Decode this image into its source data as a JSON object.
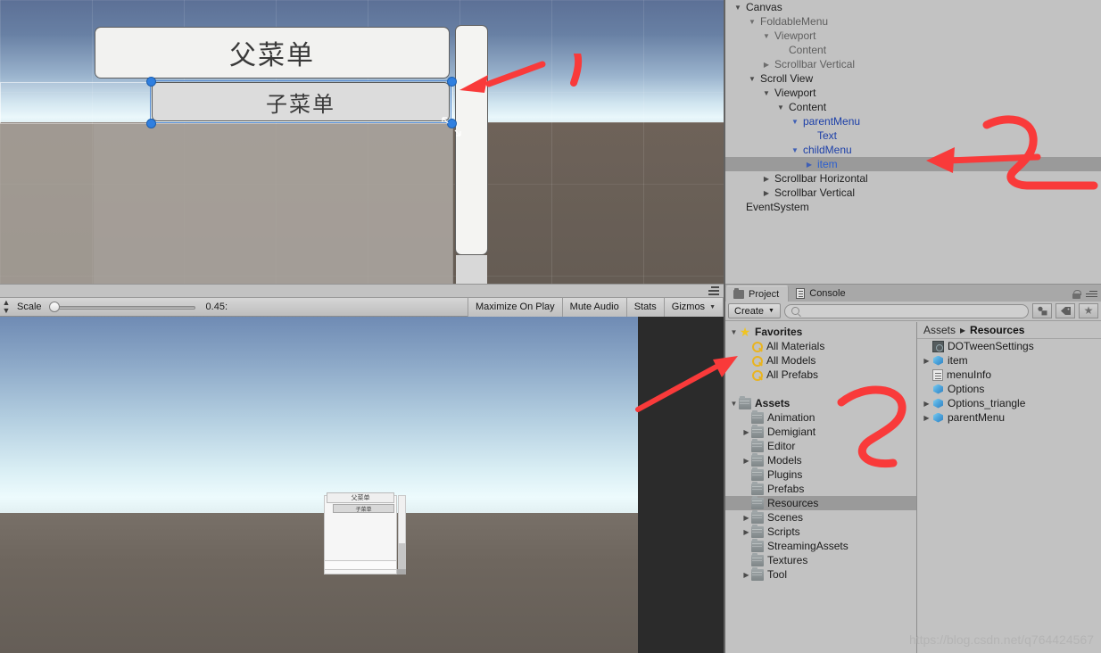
{
  "scene": {
    "parent_menu_label": "父菜单",
    "child_menu_label": "子菜单"
  },
  "game_toolbar": {
    "scale_label": "Scale",
    "scale_value": "0.45:",
    "maximize_on_play": "Maximize On Play",
    "mute_audio": "Mute Audio",
    "stats": "Stats",
    "gizmos": "Gizmos"
  },
  "game_view": {
    "parent_menu_label": "父菜单",
    "child_menu_label": "子菜单"
  },
  "hierarchy": {
    "rows": [
      {
        "label": "Canvas",
        "indent": 0,
        "arrow": "down",
        "style": "normal"
      },
      {
        "label": "FoldableMenu",
        "indent": 1,
        "arrow": "down",
        "style": "dim"
      },
      {
        "label": "Viewport",
        "indent": 2,
        "arrow": "down",
        "style": "dim"
      },
      {
        "label": "Content",
        "indent": 3,
        "arrow": "none",
        "style": "dim"
      },
      {
        "label": "Scrollbar Vertical",
        "indent": 2,
        "arrow": "right",
        "style": "dim"
      },
      {
        "label": "Scroll View",
        "indent": 1,
        "arrow": "down",
        "style": "normal"
      },
      {
        "label": "Viewport",
        "indent": 2,
        "arrow": "down",
        "style": "normal"
      },
      {
        "label": "Content",
        "indent": 3,
        "arrow": "down",
        "style": "normal"
      },
      {
        "label": "parentMenu",
        "indent": 4,
        "arrow": "down",
        "style": "blue"
      },
      {
        "label": "Text",
        "indent": 5,
        "arrow": "none",
        "style": "blue"
      },
      {
        "label": "childMenu",
        "indent": 4,
        "arrow": "down",
        "style": "blue"
      },
      {
        "label": "item",
        "indent": 5,
        "arrow": "right",
        "style": "blue",
        "selected": true
      },
      {
        "label": "Scrollbar Horizontal",
        "indent": 2,
        "arrow": "right",
        "style": "normal"
      },
      {
        "label": "Scrollbar Vertical",
        "indent": 2,
        "arrow": "right",
        "style": "normal"
      },
      {
        "label": "EventSystem",
        "indent": 0,
        "arrow": "none",
        "style": "normal"
      }
    ]
  },
  "project": {
    "tabs": [
      {
        "label": "Project",
        "icon": "project-icon",
        "active": true
      },
      {
        "label": "Console",
        "icon": "console-icon",
        "active": false
      }
    ],
    "create_label": "Create",
    "search_placeholder": "",
    "search_value": "",
    "tree": [
      {
        "label": "Favorites",
        "indent": 0,
        "arrow": "down",
        "icon": "star-icon",
        "bold": true
      },
      {
        "label": "All Materials",
        "indent": 1,
        "arrow": "none",
        "icon": "search-icon",
        "bold": false
      },
      {
        "label": "All Models",
        "indent": 1,
        "arrow": "none",
        "icon": "search-icon",
        "bold": false
      },
      {
        "label": "All Prefabs",
        "indent": 1,
        "arrow": "none",
        "icon": "search-icon",
        "bold": false
      },
      {
        "label": "",
        "indent": 0,
        "arrow": "none",
        "icon": "none",
        "bold": false
      },
      {
        "label": "Assets",
        "indent": 0,
        "arrow": "down",
        "icon": "folder-icon",
        "bold": true
      },
      {
        "label": "Animation",
        "indent": 1,
        "arrow": "none",
        "icon": "folder-icon",
        "bold": false
      },
      {
        "label": "Demigiant",
        "indent": 1,
        "arrow": "right",
        "icon": "folder-icon",
        "bold": false
      },
      {
        "label": "Editor",
        "indent": 1,
        "arrow": "none",
        "icon": "folder-icon",
        "bold": false
      },
      {
        "label": "Models",
        "indent": 1,
        "arrow": "right",
        "icon": "folder-icon",
        "bold": false
      },
      {
        "label": "Plugins",
        "indent": 1,
        "arrow": "none",
        "icon": "folder-icon",
        "bold": false
      },
      {
        "label": "Prefabs",
        "indent": 1,
        "arrow": "none",
        "icon": "folder-icon",
        "bold": false
      },
      {
        "label": "Resources",
        "indent": 1,
        "arrow": "none",
        "icon": "folder-icon",
        "bold": false,
        "selected": true
      },
      {
        "label": "Scenes",
        "indent": 1,
        "arrow": "right",
        "icon": "folder-icon",
        "bold": false
      },
      {
        "label": "Scripts",
        "indent": 1,
        "arrow": "right",
        "icon": "folder-icon",
        "bold": false
      },
      {
        "label": "StreamingAssets",
        "indent": 1,
        "arrow": "none",
        "icon": "folder-icon",
        "bold": false
      },
      {
        "label": "Textures",
        "indent": 1,
        "arrow": "none",
        "icon": "folder-icon",
        "bold": false
      },
      {
        "label": "Tool",
        "indent": 1,
        "arrow": "right",
        "icon": "folder-icon",
        "bold": false
      }
    ],
    "breadcrumb": {
      "root": "Assets",
      "separator": "▸",
      "current": "Resources"
    },
    "assets": [
      {
        "label": "DOTweenSettings",
        "arrow": "none",
        "icon": "dark-asset-icon"
      },
      {
        "label": "item",
        "arrow": "right",
        "icon": "prefab-cube-icon"
      },
      {
        "label": "menuInfo",
        "arrow": "none",
        "icon": "text-doc-icon"
      },
      {
        "label": "Options",
        "arrow": "none",
        "icon": "prefab-cube-icon"
      },
      {
        "label": "Options_triangle",
        "arrow": "right",
        "icon": "prefab-cube-icon"
      },
      {
        "label": "parentMenu",
        "arrow": "right",
        "icon": "prefab-cube-icon"
      }
    ]
  },
  "annotations": {
    "color": "#f93a3a",
    "marks": [
      {
        "name": "arrow-to-child-menu-handle",
        "type": "arrow"
      },
      {
        "name": "numeral-one",
        "type": "stroke"
      },
      {
        "name": "arrow-to-hierarchy-item",
        "type": "arrow"
      },
      {
        "name": "numeral-two-hierarchy",
        "type": "stroke"
      },
      {
        "name": "arrow-to-project-item",
        "type": "arrow"
      },
      {
        "name": "numeral-three-project",
        "type": "stroke"
      }
    ]
  },
  "watermark": {
    "text": "https://blog.csdn.net/q764424567"
  }
}
